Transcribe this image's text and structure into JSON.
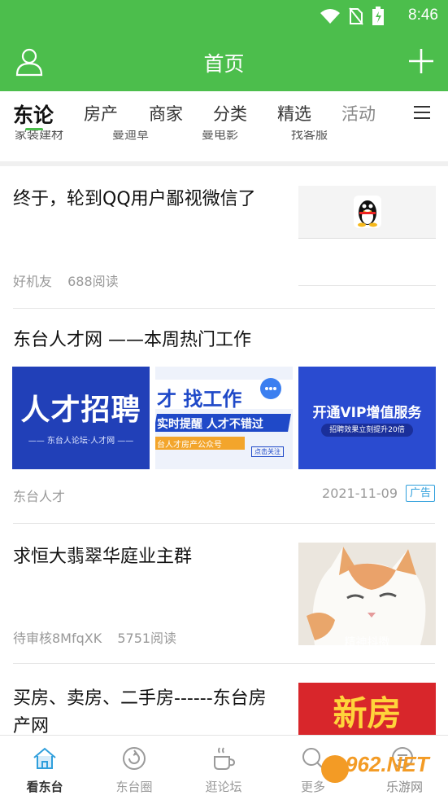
{
  "status": {
    "time": "8:46"
  },
  "header": {
    "title": "首页"
  },
  "tabs": [
    {
      "label": "东论",
      "active": true
    },
    {
      "label": "房产"
    },
    {
      "label": "商家"
    },
    {
      "label": "分类"
    },
    {
      "label": "精选"
    },
    {
      "label": "活动"
    }
  ],
  "subrow": [
    "家装建材",
    "曼迪草",
    "曼电影",
    "找客服"
  ],
  "articles": [
    {
      "title": "终于，轮到QQ用户鄙视微信了",
      "author": "好机友",
      "reads": "688阅读"
    },
    {
      "title": "东台人才网 ——本周热门工作",
      "author": "东台人才",
      "date": "2021-11-09",
      "badge": "广告",
      "images": [
        {
          "line1": "人才招聘",
          "line2": "—— 东台人论坛·人才网 ——"
        },
        {
          "line1": "才 找工作",
          "line2": "实时提醒  人才不错过",
          "line3": "台人才房产公众号",
          "line4": "点击关注"
        },
        {
          "line1": "开通VIP增值服务",
          "line2": "招聘效果立刻提升20倍"
        }
      ]
    },
    {
      "title": "求恒大翡翠华庭业主群",
      "author": "待审核8MfqXK",
      "reads": "5751阅读",
      "img_caption": "精神抖擞"
    },
    {
      "title_l1": "买房、卖房、二手房------东台房",
      "title_l2": "产网",
      "img_text": "新房"
    }
  ],
  "bottom_nav": [
    {
      "label": "看东台",
      "icon": "home-icon",
      "active": true
    },
    {
      "label": "东台圈",
      "icon": "circle-refresh-icon"
    },
    {
      "label": "逛论坛",
      "icon": "coffee-cup-icon"
    },
    {
      "label": "更多",
      "icon": "search-icon"
    },
    {
      "label": "",
      "icon": "chat-icon"
    }
  ],
  "watermark": {
    "line1": "962.NET",
    "line2": "乐游网"
  },
  "colors": {
    "brand_green": "#4cbe4c",
    "ad_blue": "#2f9fdc",
    "banner_blue": "#2140b8"
  }
}
